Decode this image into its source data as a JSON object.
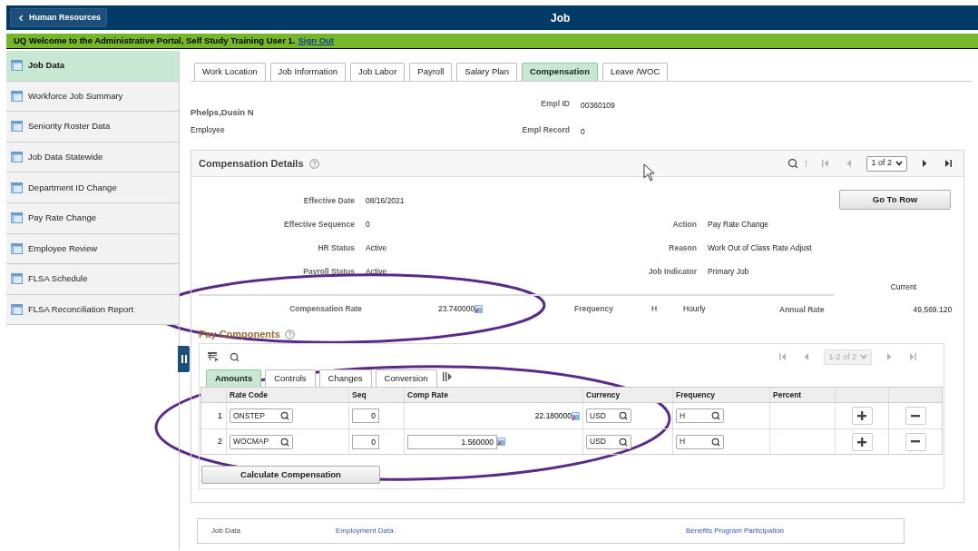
{
  "header": {
    "back_button": "Human Resources",
    "title": "Job"
  },
  "welcome": {
    "text": "UQ Welcome to the Administrative Portal, Self Study Training User 1.",
    "link": "Sign Out"
  },
  "sidebar": {
    "items": [
      {
        "label": "Job Data",
        "selected": true
      },
      {
        "label": "Workforce Job Summary",
        "selected": false
      },
      {
        "label": "Seniority Roster Data",
        "selected": false
      },
      {
        "label": "Job Data Statewide",
        "selected": false
      },
      {
        "label": "Department ID Change",
        "selected": false
      },
      {
        "label": "Pay Rate Change",
        "selected": false
      },
      {
        "label": "Employee Review",
        "selected": false
      },
      {
        "label": "FLSA Schedule",
        "selected": false
      },
      {
        "label": "FLSA Reconciliation Report",
        "selected": false
      }
    ]
  },
  "tabs": [
    {
      "label": "Work Location",
      "selected": false
    },
    {
      "label": "Job Information",
      "selected": false
    },
    {
      "label": "Job Labor",
      "selected": false
    },
    {
      "label": "Payroll",
      "selected": false
    },
    {
      "label": "Salary Plan",
      "selected": false
    },
    {
      "label": "Compensation",
      "selected": true
    },
    {
      "label": "Leave /WOC",
      "selected": false
    }
  ],
  "employee": {
    "name": "Phelps,Dusin N",
    "type": "Employee",
    "fields": [
      {
        "label": "Empl ID",
        "value": "00360109"
      },
      {
        "label": "Empl Record",
        "value": "0"
      }
    ]
  },
  "compensation_details": {
    "title": "Compensation Details",
    "pager": {
      "value": "1 of 2",
      "arrows": [
        {
          "kind": "first",
          "disabled": true
        },
        {
          "kind": "prev",
          "disabled": true
        },
        {
          "kind": "next",
          "disabled": false
        },
        {
          "kind": "last",
          "disabled": false
        }
      ]
    },
    "go_to_row": "Go To Row",
    "rows": [
      {
        "left": {
          "label": "Effective Date",
          "value": "08/16/2021"
        }
      },
      {
        "left": {
          "label": "Effective Sequence",
          "value": "0"
        },
        "right": {
          "label": "Action",
          "value": "Pay Rate Change"
        }
      },
      {
        "left": {
          "label": "HR Status",
          "value": "Active"
        },
        "right": {
          "label": "Reason",
          "value": "Work Out of Class Rate Adjust"
        }
      },
      {
        "left": {
          "label": "Payroll Status",
          "value": "Active"
        },
        "right": {
          "label": "Job Indicator",
          "value": "Primary Job"
        }
      }
    ],
    "current_label": "Current",
    "rate": {
      "label": "Compensation Rate",
      "value": "23.740000",
      "frequency_label": "Frequency",
      "frequency_code": "H",
      "frequency": "Hourly",
      "annual_label": "Annual Rate",
      "annual_value": "49,569.120"
    }
  },
  "pay_components": {
    "title": "Pay Components",
    "pager": {
      "value": "1-2 of 2",
      "arrows": [
        {
          "kind": "first",
          "disabled": true
        },
        {
          "kind": "prev",
          "disabled": true
        },
        {
          "kind": "next",
          "disabled": true
        },
        {
          "kind": "last",
          "disabled": true
        }
      ]
    },
    "tabs": [
      {
        "label": "Amounts",
        "selected": true
      },
      {
        "label": "Controls",
        "selected": false
      },
      {
        "label": "Changes",
        "selected": false
      },
      {
        "label": "Conversion",
        "selected": false
      }
    ],
    "columns": [
      "Rate Code",
      "Seq",
      "Comp Rate",
      "Currency",
      "Frequency",
      "Percent"
    ],
    "rows": [
      {
        "number": "1",
        "rate_code": "ONSTEP",
        "seq": "0",
        "comp_rate": "22.180000",
        "comp_rate_editable": false,
        "currency": "USD",
        "frequency": "H"
      },
      {
        "number": "2",
        "rate_code": "WOCMAP",
        "seq": "0",
        "comp_rate": "1.560000",
        "comp_rate_editable": true,
        "currency": "USD",
        "frequency": "H"
      }
    ],
    "calculate_button": "Calculate Compensation"
  },
  "footer_links": [
    {
      "kind": "text",
      "label": "Job Data"
    },
    {
      "kind": "link",
      "label": "Employment Data"
    },
    {
      "kind": "link",
      "label": "Benefits Program Participation"
    }
  ]
}
